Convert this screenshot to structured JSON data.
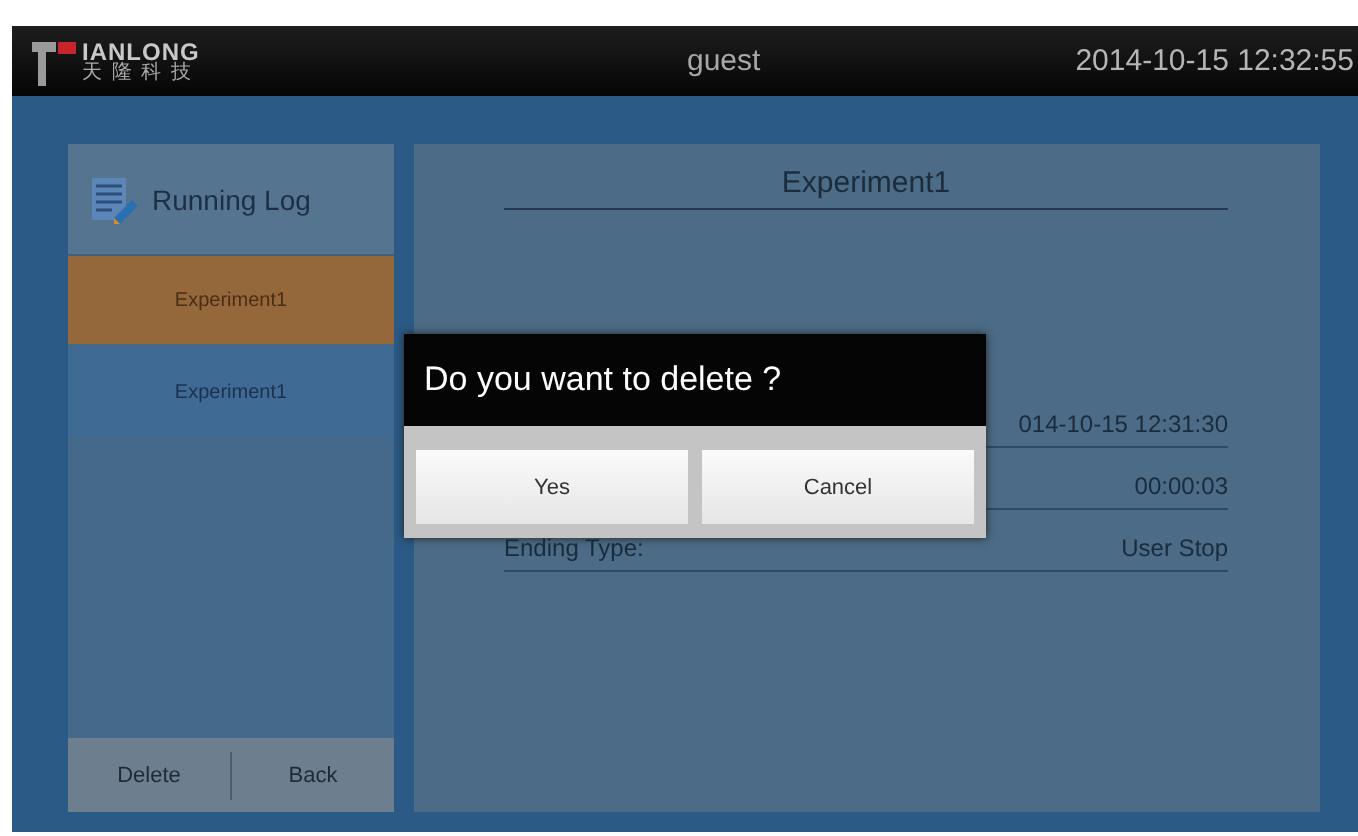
{
  "top_bar": {
    "logo": {
      "name": "IANLONG",
      "subtitle": "天 隆 科 技"
    },
    "user": "guest",
    "datetime": "2014-10-15 12:32:55"
  },
  "sidebar": {
    "title": "Running Log",
    "items": [
      {
        "label": "Experiment1",
        "selected": true
      },
      {
        "label": "Experiment1",
        "selected": false
      }
    ],
    "buttons": [
      "Delete",
      "Back"
    ]
  },
  "detail": {
    "title": "Experiment1",
    "rows": [
      {
        "value": "014-10-15 12:31:30"
      },
      {
        "value": "00:00:03"
      },
      {
        "label": "Ending Type:",
        "value": "User Stop"
      }
    ]
  },
  "dialog": {
    "message": "Do you want to delete ?",
    "buttons": [
      "Yes",
      "Cancel"
    ]
  }
}
